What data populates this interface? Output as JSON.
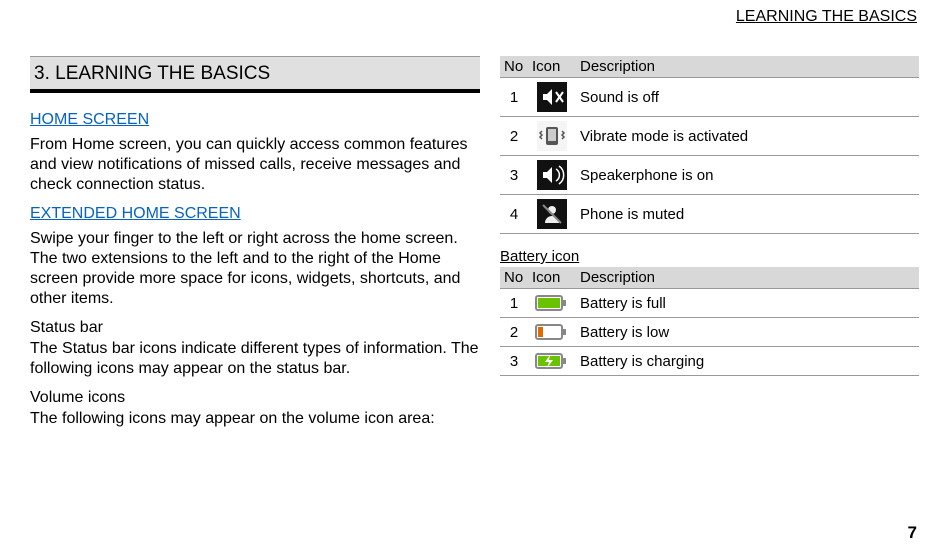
{
  "header": {
    "running": "LEARNING THE BASICS"
  },
  "chapter": {
    "title": "3. LEARNING THE BASICS"
  },
  "sections": {
    "home": {
      "heading": "HOME SCREEN",
      "body": "From Home screen, you can quickly access common features and view notifications of missed calls, receive messages and check connection status."
    },
    "ext": {
      "heading": "EXTENDED HOME SCREEN",
      "body": "Swipe your finger to the left or right across the home screen. The two extensions to the left and to the right of the Home screen provide more space for icons, widgets, shortcuts, and other items."
    },
    "status": {
      "heading": "Status bar",
      "body": "The Status bar icons indicate different types of information. The following icons may appear on the status bar."
    },
    "volume": {
      "heading": "Volume icons",
      "body": "The following icons may appear on the volume icon area:"
    },
    "battery": {
      "heading": "Battery icon"
    }
  },
  "tables": {
    "vol_headers": {
      "no": "No",
      "icon": "Icon",
      "desc": "Description"
    },
    "bat_headers": {
      "no": "No",
      "icon": "Icon",
      "desc": "Description"
    },
    "volume": [
      {
        "n": "1",
        "icon": "sound-off-icon",
        "desc": "Sound is off"
      },
      {
        "n": "2",
        "icon": "vibrate-icon",
        "desc": "Vibrate mode is activated"
      },
      {
        "n": "3",
        "icon": "speakerphone-icon",
        "desc": "Speakerphone is on"
      },
      {
        "n": "4",
        "icon": "mute-icon",
        "desc": "Phone is muted"
      }
    ],
    "battery": [
      {
        "n": "1",
        "icon": "battery-full-icon",
        "desc": "Battery is full"
      },
      {
        "n": "2",
        "icon": "battery-low-icon",
        "desc": "Battery is low"
      },
      {
        "n": "3",
        "icon": "battery-charging-icon",
        "desc": "Battery is charging"
      }
    ]
  },
  "page": {
    "number": "7"
  }
}
